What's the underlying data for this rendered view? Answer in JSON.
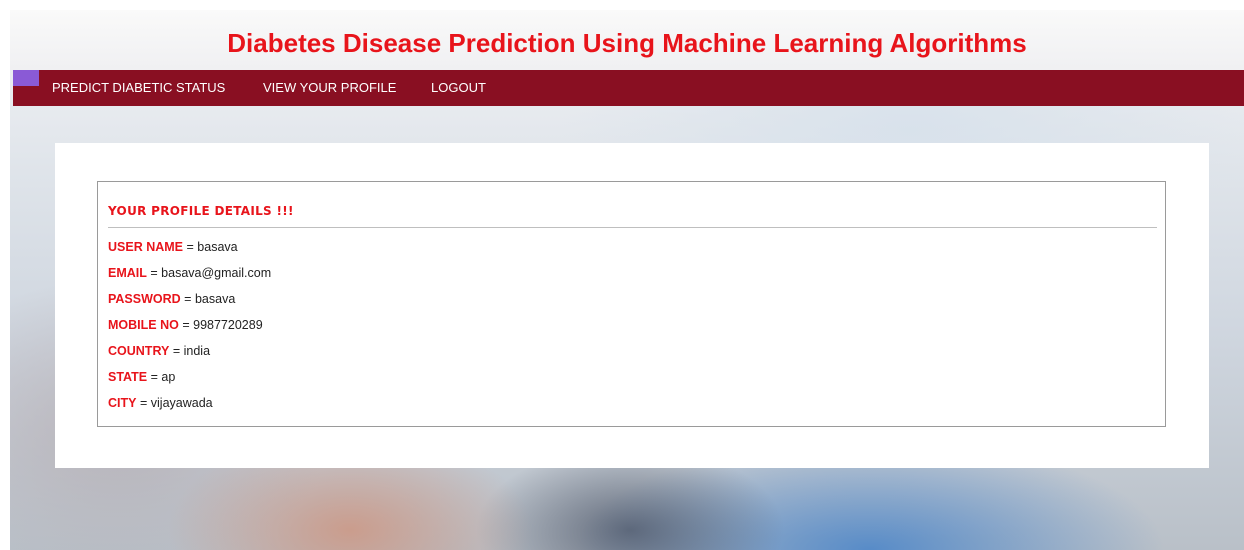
{
  "header": {
    "title": "Diabetes Disease Prediction Using Machine Learning Algorithms"
  },
  "nav": {
    "items": [
      {
        "label": "PREDICT DIABETIC STATUS"
      },
      {
        "label": "VIEW YOUR PROFILE"
      },
      {
        "label": "LOGOUT"
      }
    ]
  },
  "profile": {
    "heading": "YOUR PROFILE DETAILS !!!",
    "separator": "=",
    "fields": [
      {
        "label": "USER NAME",
        "value": "basava"
      },
      {
        "label": "EMAIL",
        "value": "basava@gmail.com"
      },
      {
        "label": "PASSWORD",
        "value": "basava"
      },
      {
        "label": "MOBILE NO",
        "value": "9987720289"
      },
      {
        "label": "COUNTRY",
        "value": "india"
      },
      {
        "label": "STATE",
        "value": "ap"
      },
      {
        "label": "CITY",
        "value": "vijayawada"
      }
    ]
  },
  "colors": {
    "title_red": "#e8141b",
    "navbar": "#890f22",
    "nav_accent": "#8a5ad6"
  }
}
